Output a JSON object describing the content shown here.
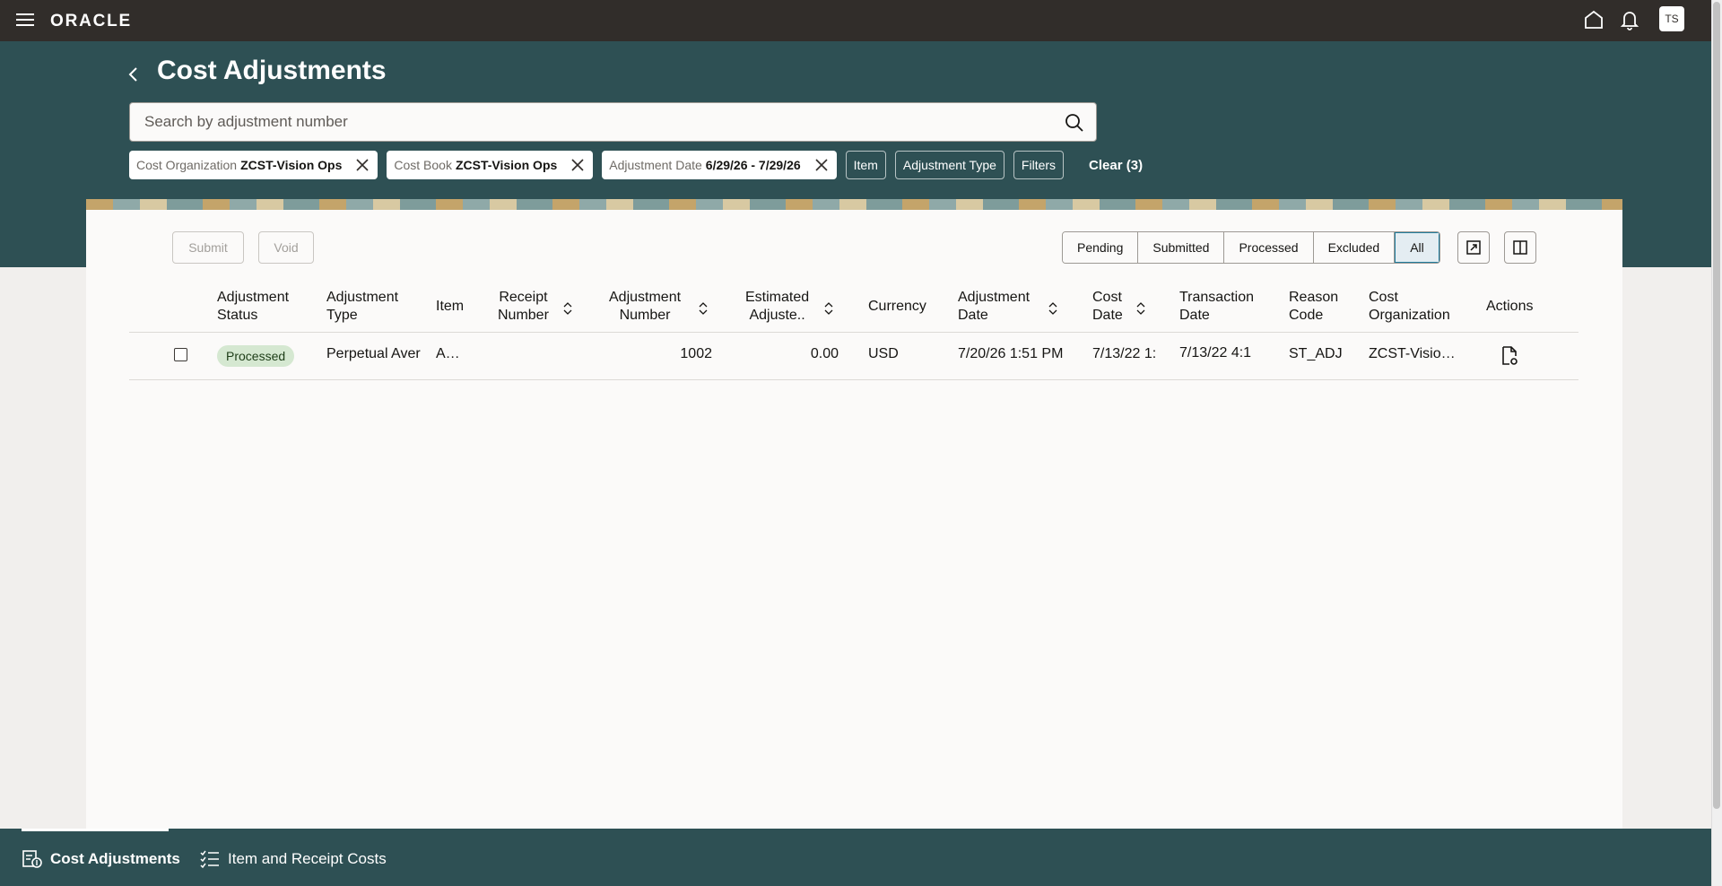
{
  "app": {
    "logo": "ORACLE",
    "user_initials": "TS"
  },
  "page": {
    "title": "Cost Adjustments"
  },
  "search": {
    "placeholder": "Search by adjustment number"
  },
  "filters": {
    "chips": [
      {
        "label": "Cost Organization",
        "value": "ZCST-Vision Ops"
      },
      {
        "label": "Cost Book",
        "value": "ZCST-Vision Ops"
      },
      {
        "label": "Adjustment Date",
        "value": "6/29/26 - 7/29/26"
      }
    ],
    "buttons": [
      "Item",
      "Adjustment Type",
      "Filters"
    ],
    "clear_label": "Clear (3)"
  },
  "actions": {
    "submit": "Submit",
    "void": "Void"
  },
  "status_tabs": [
    "Pending",
    "Submitted",
    "Processed",
    "Excluded",
    "All"
  ],
  "active_status_tab": "All",
  "table": {
    "headers": {
      "status": [
        "Adjustment",
        "Status"
      ],
      "type": [
        "Adjustment",
        "Type"
      ],
      "item": [
        "Item"
      ],
      "receipt": [
        "Receipt",
        "Number"
      ],
      "adj_number": [
        "Adjustment",
        "Number"
      ],
      "estimated": [
        "Estimated",
        "Adjuste.."
      ],
      "currency": [
        "Currency"
      ],
      "adj_date": [
        "Adjustment",
        "Date"
      ],
      "cost_date": [
        "Cost",
        "Date"
      ],
      "txn_date": [
        "Transaction",
        "Date"
      ],
      "reason": [
        "Reason",
        "Code"
      ],
      "cost_org": [
        "Cost",
        "Organization"
      ],
      "actions": [
        "Actions"
      ]
    },
    "rows": [
      {
        "status": "Processed",
        "type": "Perpetual Aver",
        "item": "A…",
        "receipt": "",
        "adj_number": "1002",
        "estimated": "0.00",
        "currency": "USD",
        "adj_date": "7/20/26 1:51 PM",
        "cost_date": "7/13/22 1:",
        "txn_date": "7/13/22 4:1",
        "reason": "ST_ADJ",
        "cost_org": "ZCST-Visio…"
      }
    ]
  },
  "bottom_nav": [
    {
      "label": "Cost Adjustments",
      "active": true
    },
    {
      "label": "Item and Receipt Costs",
      "active": false
    }
  ],
  "colors": {
    "topbar": "#312d2a",
    "band": "#2e5054",
    "badge_processed": "#d5e8d1"
  }
}
